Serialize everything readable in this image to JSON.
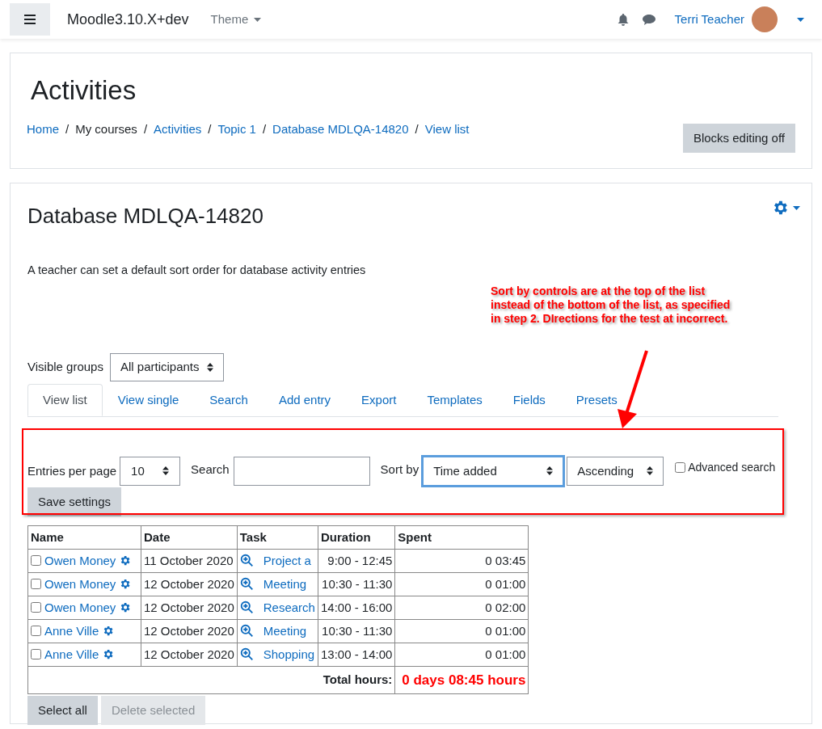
{
  "navbar": {
    "site_name": "Moodle3.10.X+dev",
    "theme_menu": "Theme",
    "user_name": "Terri Teacher"
  },
  "header": {
    "title": "Activities",
    "breadcrumb": [
      {
        "label": "Home",
        "link": true
      },
      {
        "separator": "/",
        "label": "My courses",
        "link": false
      },
      {
        "separator": "/",
        "label": "Activities",
        "link": true
      },
      {
        "separator": "/",
        "label": "Topic 1",
        "link": true
      },
      {
        "separator": "/",
        "label": "Database MDLQA-14820",
        "link": true
      },
      {
        "separator": "/",
        "label": "View list",
        "link": true
      }
    ],
    "button": "Blocks editing off"
  },
  "main": {
    "title": "Database MDLQA-14820",
    "description": "A teacher can set a default sort order for database activity entries",
    "visible_groups": {
      "label": "Visible groups",
      "value": "All participants"
    },
    "tabs": [
      {
        "label": "View list",
        "selected": true
      },
      {
        "label": "View single",
        "selected": false
      },
      {
        "label": "Search",
        "selected": false
      },
      {
        "label": "Add entry",
        "selected": false
      },
      {
        "label": "Export",
        "selected": false
      },
      {
        "label": "Templates",
        "selected": false
      },
      {
        "label": "Fields",
        "selected": false
      },
      {
        "label": "Presets",
        "selected": false
      }
    ],
    "controls": {
      "entries_label": "Entries per page",
      "entries_value": "10",
      "search_label": "Search",
      "sort_label": "Sort by",
      "sort_value": "Time added",
      "sort_focused": true,
      "order_value": "Ascending",
      "advanced_label": "Advanced search",
      "advanced_checked": false,
      "save_button": "Save settings"
    },
    "table": {
      "columns": [
        "Name",
        "Date",
        "Task",
        "Duration",
        "Spent"
      ],
      "rows": [
        {
          "checked": false,
          "name": "Owen Money",
          "date": "11 October 2020",
          "task": "Project a",
          "duration": "9:00 - 12:45",
          "spent": "0 03:45"
        },
        {
          "checked": false,
          "name": "Owen Money",
          "date": "12 October 2020",
          "task": "Meeting",
          "duration": "10:30 - 11:30",
          "spent": "0 01:00"
        },
        {
          "checked": false,
          "name": "Owen Money",
          "date": "12 October 2020",
          "task": "Research",
          "duration": "14:00 - 16:00",
          "spent": "0 02:00"
        },
        {
          "checked": false,
          "name": "Anne Ville",
          "date": "12 October 2020",
          "task": "Meeting",
          "duration": "10:30 - 11:30",
          "spent": "0 01:00"
        },
        {
          "checked": false,
          "name": "Anne Ville",
          "date": "12 October 2020",
          "task": "Shopping",
          "duration": "13:00 - 14:00",
          "spent": "0 01:00"
        }
      ],
      "total_label": "Total hours:",
      "total_value": "0 days 08:45 hours"
    },
    "buttons": [
      {
        "label": "Select all",
        "disabled": false
      },
      {
        "label": "Delete selected",
        "disabled": true
      }
    ]
  },
  "annotation": {
    "text": "Sort by controls are at the top of the list instead of the bottom of the list, as specified in step 2. DIrections for the test at incorrect."
  }
}
